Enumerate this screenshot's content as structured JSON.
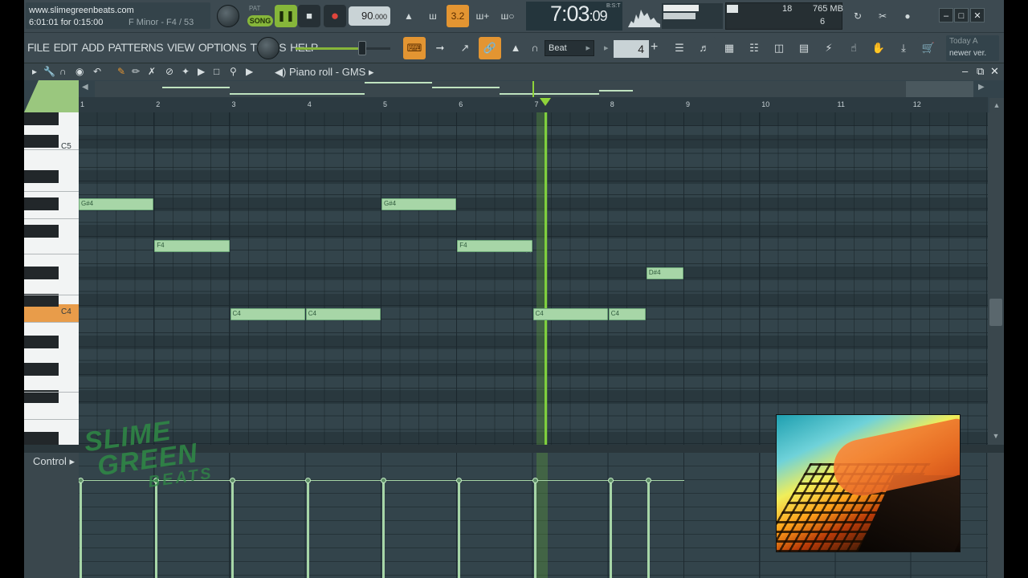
{
  "hint_panel": {
    "url": "www.slimegreenbeats.com",
    "time": "6:01:01 for 0:15:00",
    "key": "F Minor - F4 / 53"
  },
  "transport": {
    "pattern_label": "PAT",
    "song_label": "SONG",
    "pause_icon": "pause-icon",
    "stop_icon": "stop-icon",
    "record_icon": "record-icon",
    "tempo_whole": "90",
    "tempo_fraction": ".000",
    "metronome_icon": "metronome-icon",
    "countdown_label": "3.2"
  },
  "time_display": {
    "main": "7:03",
    "sub": ":09",
    "mode": "B:S:T"
  },
  "monitor": {
    "cpu": "18",
    "memory": "765 MB",
    "polyphony": "6"
  },
  "window": {
    "minimize": "–",
    "maximize": "□",
    "close": "✕"
  },
  "menu": [
    "FILE",
    "EDIT",
    "ADD",
    "PATTERNS",
    "VIEW",
    "OPTIONS",
    "TOOLS",
    "HELP"
  ],
  "snap": {
    "value": "Beat"
  },
  "step": {
    "value": "4"
  },
  "news": {
    "line1": "Today  A",
    "line2": "newer ver."
  },
  "piano_roll": {
    "title": "Piano roll - GMS",
    "arrow": "▸",
    "minimize": "–",
    "maximize": "⧉",
    "close": "✕"
  },
  "ruler": [
    "1",
    "2",
    "3",
    "4",
    "5",
    "6",
    "7",
    "8",
    "9",
    "10",
    "11",
    "12"
  ],
  "keyboard_labels": {
    "c5": "C5",
    "c4": "C4"
  },
  "notes": [
    {
      "label": "G#4",
      "start": 1,
      "length": 1
    },
    {
      "label": "F4",
      "start": 2,
      "length": 1
    },
    {
      "label": "C4",
      "start": 3,
      "length": 1
    },
    {
      "label": "C4",
      "start": 4,
      "length": 1
    },
    {
      "label": "G#4",
      "start": 5,
      "length": 1
    },
    {
      "label": "F4",
      "start": 6,
      "length": 1
    },
    {
      "label": "C4",
      "start": 7,
      "length": 1
    },
    {
      "label": "C4",
      "start": 8,
      "length": 0.5
    },
    {
      "label": "D#4",
      "start": 8.5,
      "length": 0.5
    }
  ],
  "control": {
    "label": "Control"
  },
  "watermark": {
    "line1": "SLIME",
    "line2": "GREEN",
    "line3": "BEATS"
  },
  "colors": {
    "accent_green": "#86b63a",
    "accent_orange": "#e39532",
    "note_fill": "#a7d6a7",
    "background": "#33434b"
  }
}
